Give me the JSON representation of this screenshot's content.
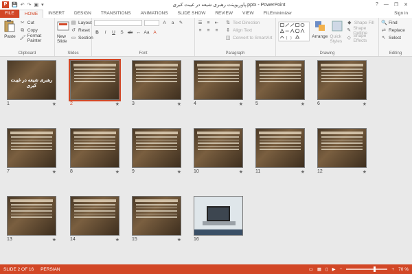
{
  "window": {
    "title": "پاورپوینت رهبری شیعه در غیبت کبری.pptx - PowerPoint",
    "app_icon": "P",
    "controls": [
      "?",
      "—",
      "❐",
      "✕"
    ]
  },
  "tabs": [
    {
      "label": "FILE"
    },
    {
      "label": "HOME"
    },
    {
      "label": "INSERT"
    },
    {
      "label": "DESIGN"
    },
    {
      "label": "TRANSITIONS"
    },
    {
      "label": "ANIMATIONS"
    },
    {
      "label": "SLIDE SHOW"
    },
    {
      "label": "REVIEW"
    },
    {
      "label": "VIEW"
    },
    {
      "label": "FILEminimizer"
    }
  ],
  "signin": "Sign in",
  "ribbon": {
    "clipboard": {
      "paste": "Paste",
      "cut": "Cut",
      "copy": "Copy",
      "painter": "Format Painter",
      "label": "Clipboard"
    },
    "slides": {
      "new_slide": "New Slide",
      "layout": "Layout",
      "reset": "Reset",
      "section": "Section",
      "label": "Slides"
    },
    "font": {
      "label": "Font"
    },
    "paragraph": {
      "text_direction": "Text Direction",
      "align_text": "Align Text",
      "smartart": "Convert to SmartArt",
      "label": "Paragraph"
    },
    "drawing": {
      "arrange": "Arrange",
      "quick_styles": "Quick Styles",
      "shape_fill": "Shape Fill",
      "shape_outline": "Shape Outline",
      "shape_effects": "Shape Effects",
      "label": "Drawing"
    },
    "editing": {
      "find": "Find",
      "replace": "Replace",
      "select": "Select",
      "label": "Editing"
    }
  },
  "slides": [
    {
      "n": "1",
      "title_text": "رهبری شیعه در غیبت کبری"
    },
    {
      "n": "2"
    },
    {
      "n": "3"
    },
    {
      "n": "4"
    },
    {
      "n": "5"
    },
    {
      "n": "6"
    },
    {
      "n": "7"
    },
    {
      "n": "8"
    },
    {
      "n": "9"
    },
    {
      "n": "10"
    },
    {
      "n": "11"
    },
    {
      "n": "12"
    },
    {
      "n": "13"
    },
    {
      "n": "14"
    },
    {
      "n": "15"
    },
    {
      "n": "16"
    }
  ],
  "selected_slide": 2,
  "status": {
    "slide_info": "SLIDE 2 OF 16",
    "language": "PERSIAN",
    "zoom": "70 %"
  },
  "colors": {
    "accent": "#d24726"
  }
}
